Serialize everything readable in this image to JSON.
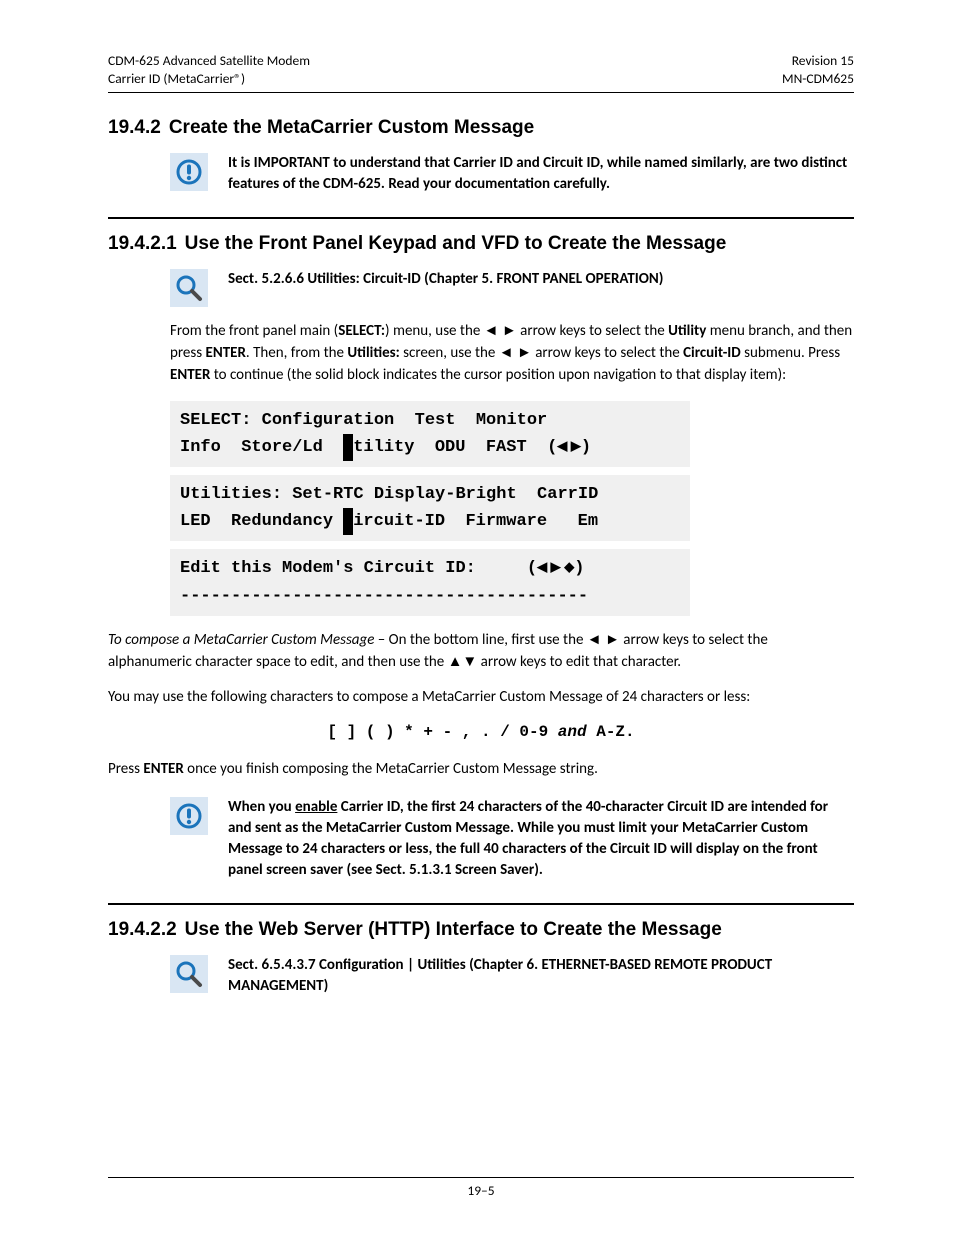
{
  "header": {
    "left_line1": "CDM-625 Advanced Satellite Modem",
    "left_line2": "Carrier ID (MetaCarrier®)",
    "right_line1": "Revision 15",
    "right_line2": "MN-CDM625"
  },
  "sec_19_4_2": {
    "num": "19.4.2",
    "title": "Create the MetaCarrier Custom Message",
    "note": "It is IMPORTANT to understand that Carrier ID and Circuit ID, while named similarly, are two distinct features of the CDM-625. Read your documentation carefully."
  },
  "sec_19_4_2_1": {
    "num": "19.4.2.1",
    "title": "Use the Front Panel Keypad and VFD to Create the Message",
    "ref": "Sect. 5.2.6.6 Utilities: Circuit-ID (Chapter 5. FRONT PANEL OPERATION)",
    "para1_a": "From the front panel main (",
    "para1_b": ") menu, use the  ◄ ►  arrow keys to select the ",
    "para1_c": " menu branch, and then press ",
    "para1_d": ". Then, from the ",
    "para1_e": " screen, use the ◄ ► arrow keys to select the ",
    "para1_f": " submenu. Press ",
    "para1_g": " to continue (the solid block indicates the cursor position upon navigation to that display item):",
    "select_label": "SELECT:",
    "utility_label": "Utility",
    "enter_label": "ENTER",
    "utilities_label": "Utilities:",
    "circuitid_label": "Circuit-ID",
    "vfd1_line1": "SELECT: Configuration  Test  Monitor",
    "vfd1_line2a": "Info  Store/Ld  ",
    "vfd1_line2b": "tility  ODU  FAST  (",
    "vfd1_line2c": ")",
    "vfd2_line1": "Utilities: Set-RTC Display-Bright  CarrID",
    "vfd2_line2a": "LED  Redundancy ",
    "vfd2_line2b": "ircuit-ID  Firmware   Em",
    "vfd3_line1a": "Edit this Modem's Circuit ID:     (",
    "vfd3_line1b": ")",
    "vfd3_line2": "----------------------------------------",
    "para2_a": "To compose a MetaCarrier Custom Message",
    "para2_b": " – On the bottom line, first use the ◄ ► arrow keys to select the alphanumeric character space to edit, and then use the ▲▼ arrow keys to edit that character.",
    "para3": "You may use the following characters to compose a MetaCarrier Custom Message of 24 characters or less:",
    "charset_a": "[    ] ( ) * + - , . / 0-9 ",
    "charset_and": "and",
    "charset_b": " A-Z.",
    "para4_a": "Press ",
    "para4_b": " once you finish composing the MetaCarrier Custom Message string.",
    "note2_a": "When you ",
    "note2_enable": "enable",
    "note2_b": " Carrier ID, the first 24 characters of the 40-character Circuit ID are intended for and sent as the MetaCarrier Custom Message. While you must limit your MetaCarrier Custom Message to 24 characters or less, the full 40 characters of the Circuit ID will display on the front panel screen saver (see Sect. 5.1.3.1 Screen Saver)."
  },
  "sec_19_4_2_2": {
    "num": "19.4.2.2",
    "title": "Use the Web Server (HTTP) Interface to Create the Message",
    "ref": "Sect. 6.5.4.3.7 Configuration | Utilities (Chapter 6. ETHERNET-BASED REMOTE PRODUCT MANAGEMENT)"
  },
  "footer": {
    "page": "19–5"
  }
}
